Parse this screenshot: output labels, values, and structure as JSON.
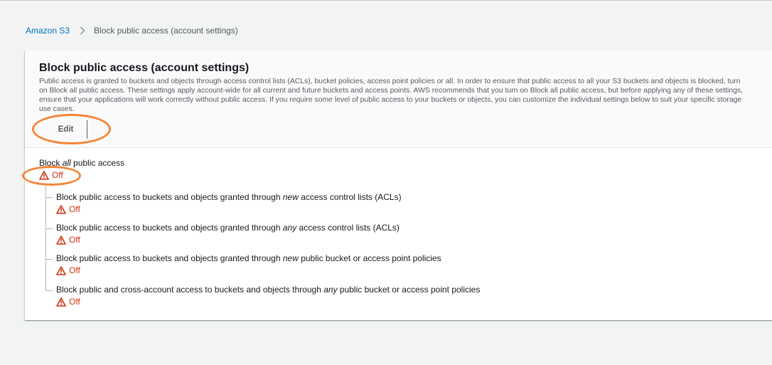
{
  "breadcrumb": {
    "root_label": "Amazon S3",
    "separator_icon": "chevron-right-icon",
    "current_label": "Block public access (account settings)"
  },
  "panel": {
    "title": "Block public access (account settings)",
    "description": "Public access is granted to buckets and objects through access control lists (ACLs), bucket policies, access point policies or all. In order to ensure that public access to all your S3 buckets and objects is blocked, turn on Block all public access. These settings apply account-wide for all current and future buckets and access points. AWS recommends that you turn on Block all public access, but before applying any of these settings, ensure that your applications will work correctly without public access. If you require some level of public access to your buckets or objects, you can customize the individual settings below to suit your specific storage use cases.",
    "edit_label": "Edit"
  },
  "block_all": {
    "label_prefix": "Block ",
    "label_emphasis": "all",
    "label_suffix": " public access",
    "status": "Off",
    "status_icon": "warning-triangle-icon"
  },
  "settings": [
    {
      "label_prefix": "Block public access to buckets and objects granted through ",
      "label_emphasis": "new",
      "label_suffix": " access control lists (ACLs)",
      "status": "Off"
    },
    {
      "label_prefix": "Block public access to buckets and objects granted through ",
      "label_emphasis": "any",
      "label_suffix": " access control lists (ACLs)",
      "status": "Off"
    },
    {
      "label_prefix": "Block public access to buckets and objects granted through ",
      "label_emphasis": "new",
      "label_suffix": " public bucket or access point policies",
      "status": "Off"
    },
    {
      "label_prefix": "Block public and cross-account access to buckets and objects through ",
      "label_emphasis": "any",
      "label_suffix": " public bucket or access point policies",
      "status": "Off"
    }
  ],
  "colors": {
    "link": "#0073bb",
    "status_off": "#d13212",
    "annotation": "#f58536",
    "background": "#f2f3f3"
  }
}
